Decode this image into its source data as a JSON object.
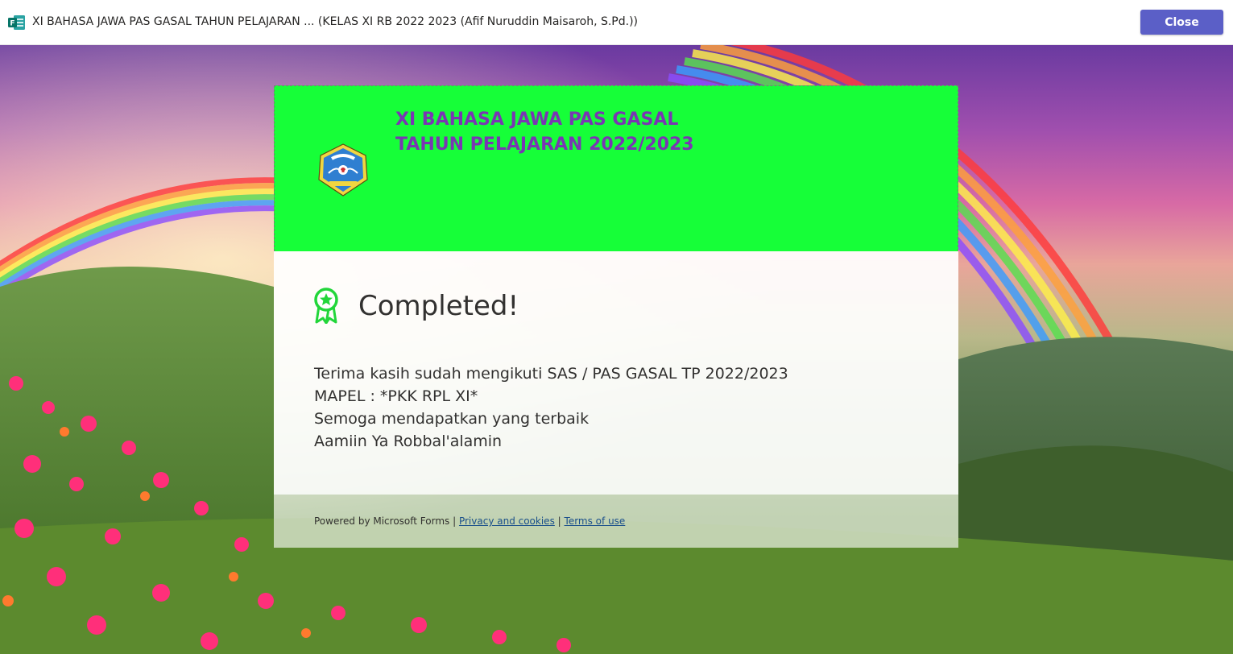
{
  "window": {
    "title": "XI BAHASA JAWA PAS GASAL TAHUN PELAJARAN ... (KELAS XI RB 2022 2023 (Afif Nuruddin Maisaroh, S.Pd.))",
    "app_icon": "microsoft-forms-icon",
    "close_label": "Close",
    "accent_color": "#5b5fc7"
  },
  "form": {
    "title_line1": "XI BAHASA JAWA PAS GASAL",
    "title_line2": "TAHUN PELAJARAN 2022/2023",
    "header_color": "#16ff38",
    "title_color": "#7a36b3",
    "logo_icon": "school-emblem-icon"
  },
  "completion": {
    "icon": "award-ribbon-icon",
    "heading": "Completed!",
    "message": [
      "Terima kasih sudah mengikuti SAS / PAS GASAL TP 2022/2023",
      "MAPEL : *PKK RPL XI*",
      "Semoga mendapatkan yang terbaik",
      "Aamiin Ya Robbal'alamin"
    ]
  },
  "footer": {
    "powered_by": "Powered by Microsoft Forms |",
    "privacy_link": "Privacy and cookies",
    "separator": "|",
    "terms_link": "Terms of use"
  }
}
